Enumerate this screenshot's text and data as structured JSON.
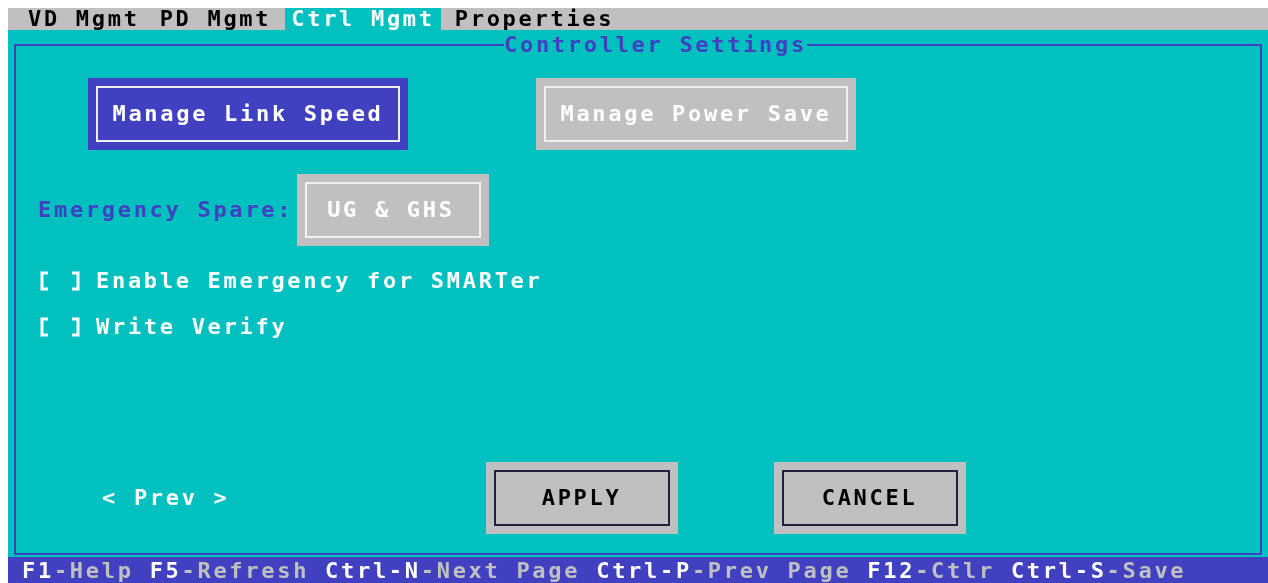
{
  "tabs": [
    {
      "label": "VD Mgmt",
      "selected": false
    },
    {
      "label": "PD Mgmt",
      "selected": false
    },
    {
      "label": "Ctrl Mgmt",
      "selected": true
    },
    {
      "label": "Properties",
      "selected": false
    }
  ],
  "panel": {
    "title": "Controller Settings",
    "top_buttons": [
      {
        "label": "Manage Link Speed",
        "focused": true
      },
      {
        "label": "Manage Power Save",
        "focused": false
      }
    ],
    "emergency_spare": {
      "label": "Emergency Spare:",
      "value": "UG & GHS"
    },
    "options": [
      {
        "label": "Enable Emergency for SMARTer",
        "checked": false
      },
      {
        "label": "Write Verify",
        "checked": false
      }
    ],
    "nav": {
      "prev": "< Prev >"
    },
    "actions": [
      {
        "label": "APPLY",
        "focused": false
      },
      {
        "label": "CANCEL",
        "focused": false
      }
    ]
  },
  "status_bar": [
    {
      "key": "F1",
      "label": "-Help"
    },
    {
      "key": "F5",
      "label": "-Refresh"
    },
    {
      "key": "Ctrl-N",
      "label": "-Next Page"
    },
    {
      "key": "Ctrl-P",
      "label": "-Prev Page"
    },
    {
      "key": "F12",
      "label": "-Ctlr"
    },
    {
      "key": "Ctrl-S",
      "label": "-Save"
    }
  ]
}
